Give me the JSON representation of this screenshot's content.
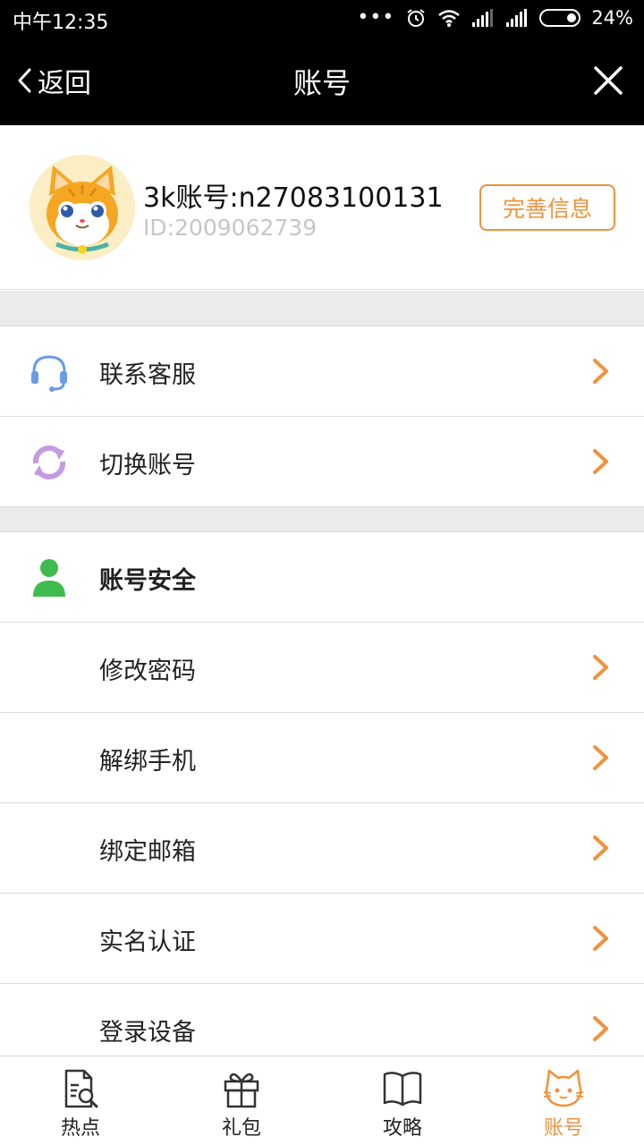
{
  "status_bar": {
    "time": "中午12:35",
    "dots": "•••",
    "battery": "24%",
    "icons": [
      "alarm-icon",
      "wifi-icon",
      "signal-icon",
      "signal-icon",
      "battery-icon"
    ]
  },
  "title_bar": {
    "back_label": "返回",
    "title": "账号",
    "close_icon": "close-icon"
  },
  "profile": {
    "account_name": "3k账号:n27083100131",
    "user_id": "ID:2009062739",
    "improve_button": "完善信息",
    "avatar_icon": "cat-avatar"
  },
  "menu": {
    "contact_service": {
      "label": "联系客服",
      "icon": "headset-icon",
      "color": "#6a9be6"
    },
    "switch_account": {
      "label": "切换账号",
      "icon": "switch-arrows-icon",
      "color": "#c49be3"
    },
    "security": {
      "label": "账号安全",
      "icon": "user-icon",
      "color": "#3fba4f",
      "items": [
        {
          "label": "修改密码"
        },
        {
          "label": "解绑手机"
        },
        {
          "label": "绑定邮箱"
        },
        {
          "label": "实名认证"
        },
        {
          "label": "登录设备"
        }
      ]
    }
  },
  "tabs": [
    {
      "label": "热点",
      "icon": "document-search-icon",
      "active": false
    },
    {
      "label": "礼包",
      "icon": "gift-icon",
      "active": false
    },
    {
      "label": "攻略",
      "icon": "book-icon",
      "active": false
    },
    {
      "label": "账号",
      "icon": "cat-icon",
      "active": true
    }
  ],
  "colors": {
    "accent": "#f0923a",
    "header_bg": "#000000",
    "divider_bg": "#ebebeb"
  }
}
